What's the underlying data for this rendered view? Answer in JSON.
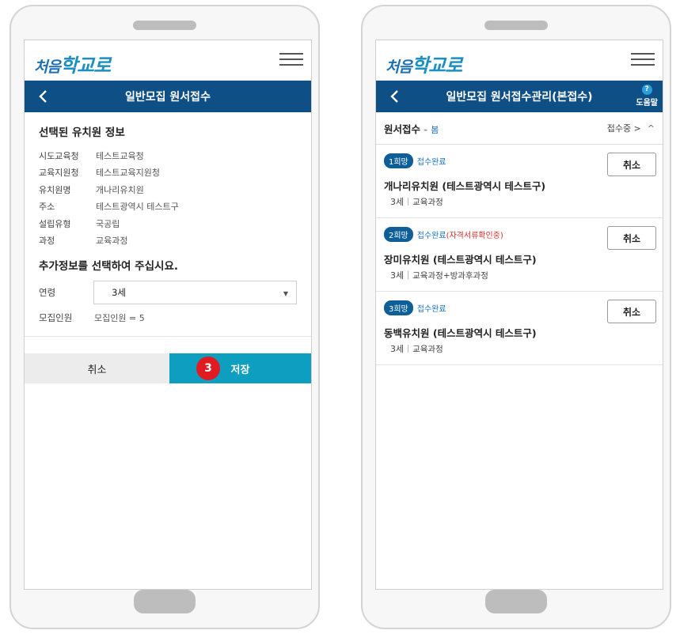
{
  "left_screen": {
    "logo": {
      "prefix": "처음",
      "main": "학교로"
    },
    "title": "일반모집 원서접수",
    "kindergarten_info": {
      "heading": "선택된 유치원 정보",
      "rows": [
        {
          "key": "시도교육청",
          "value": "테스트교육청"
        },
        {
          "key": "교육지원청",
          "value": "테스트교육지원청"
        },
        {
          "key": "유치원명",
          "value": "개나리유치원"
        },
        {
          "key": "주소",
          "value": "테스트광역시 테스트구"
        },
        {
          "key": "설립유형",
          "value": "국공립"
        },
        {
          "key": "과정",
          "value": "교육과정"
        }
      ]
    },
    "extra_info": {
      "heading": "추가정보를 선택하여 주십시요.",
      "age_label": "연령",
      "age_selected": "3세",
      "quota_label": "모집인원",
      "quota_value": "모집인원 = 5"
    },
    "buttons": {
      "cancel": "취소",
      "save": "저장",
      "step_badge": "3"
    }
  },
  "right_screen": {
    "logo": {
      "prefix": "처음",
      "main": "학교로"
    },
    "title": "일반모집 원서접수관리(본접수)",
    "help_label": "도움말",
    "help_icon": "?",
    "list_header": {
      "label": "원서접수",
      "separator": "-",
      "season": "봄",
      "toggle": "접수중 >",
      "collapse_icon": "^"
    },
    "applications": [
      {
        "rank": "1희망",
        "status": "접수완료",
        "status_extra": "",
        "name": "개나리유치원 (테스트광역시 테스트구)",
        "age": "3세",
        "course": "교육과정",
        "cancel": "취소"
      },
      {
        "rank": "2희망",
        "status": "접수완료",
        "status_extra": "(자격서류확인중)",
        "name": "장미유치원 (테스트광역시 테스트구)",
        "age": "3세",
        "course": "교육과정+방과후과정",
        "cancel": "취소"
      },
      {
        "rank": "3희망",
        "status": "접수완료",
        "status_extra": "",
        "name": "동백유치원 (테스트광역시 테스트구)",
        "age": "3세",
        "course": "교육과정",
        "cancel": "취소"
      }
    ]
  },
  "colors": {
    "title_bar": "#0e4f86",
    "save_button": "#0e9ec0",
    "step_badge": "#e11b22",
    "status_text": "#1a73c7",
    "status_extra_text": "#d9302c"
  }
}
